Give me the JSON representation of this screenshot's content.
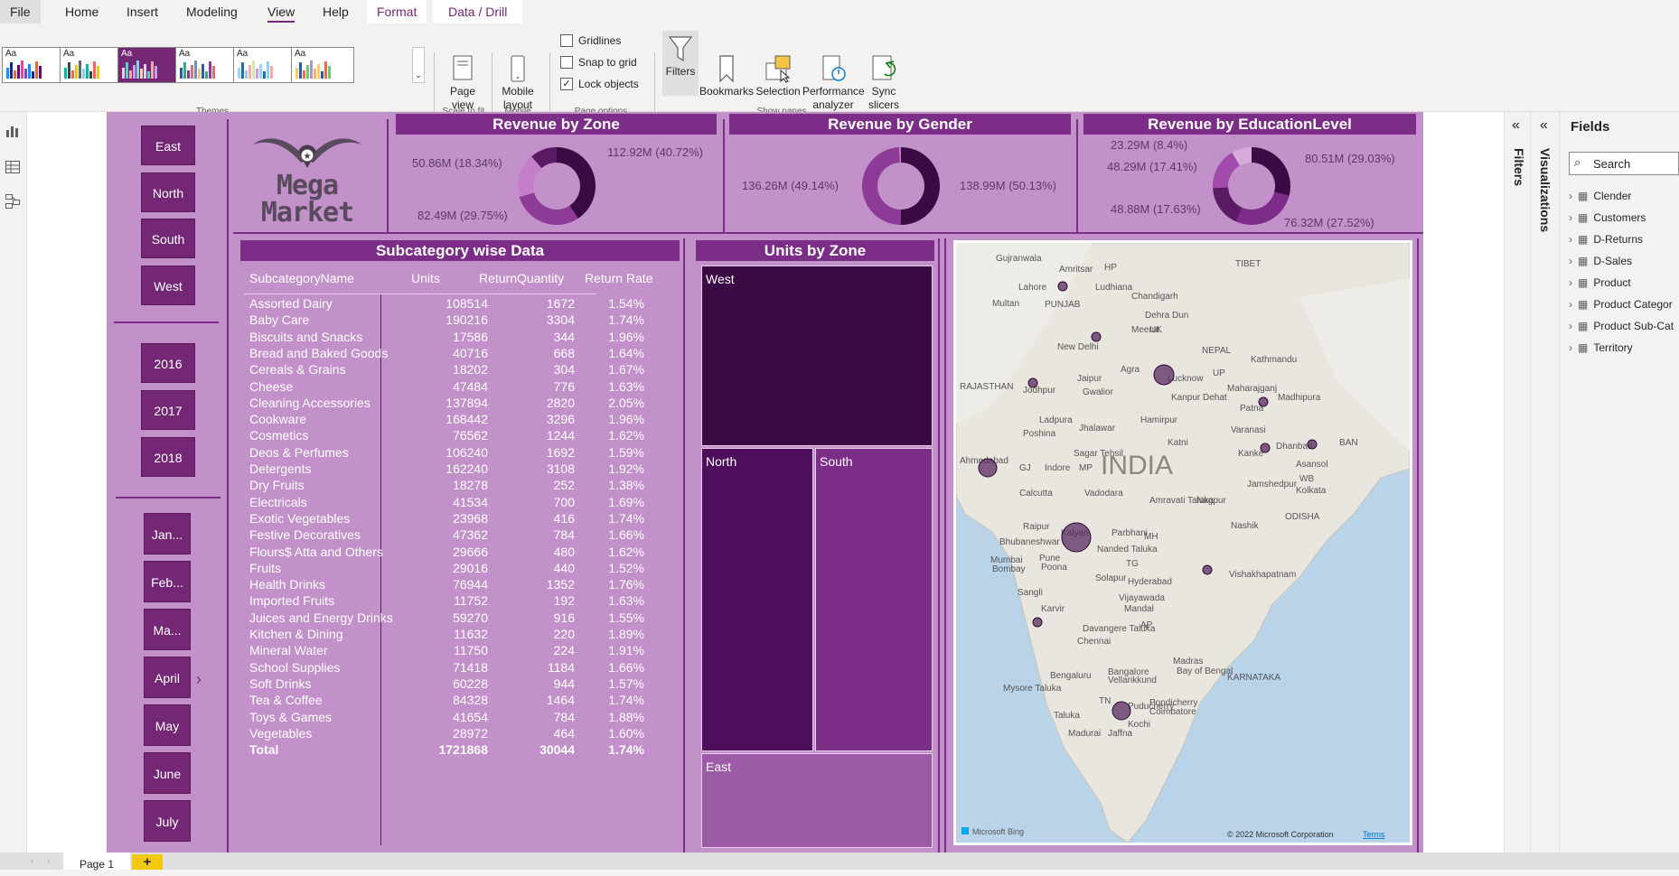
{
  "menu": {
    "file": "File",
    "home": "Home",
    "insert": "Insert",
    "modeling": "Modeling",
    "view": "View",
    "help": "Help",
    "format": "Format",
    "data_drill": "Data / Drill"
  },
  "ribbon": {
    "themes_label": "Themes",
    "page_view": "Page view",
    "mobile_layout": "Mobile layout",
    "scale_to_fit": "Scale to fit",
    "mobile": "Mobile",
    "gridlines": "Gridlines",
    "snap_to_grid": "Snap to grid",
    "lock_objects": "Lock objects",
    "page_options": "Page options",
    "filters": "Filters",
    "bookmarks": "Bookmarks",
    "selection": "Selection",
    "performance_analyzer": "Performance analyzer",
    "sync_slicers": "Sync slicers",
    "show_panes": "Show panes",
    "theme_aa": "Aa"
  },
  "logo": {
    "line1": "Mega",
    "line2": "Market"
  },
  "slicers": {
    "zones": [
      "East",
      "North",
      "South",
      "West"
    ],
    "years": [
      "2016",
      "2017",
      "2018"
    ],
    "months": [
      "Jan...",
      "Feb...",
      "Ma...",
      "April",
      "May",
      "June",
      "July"
    ]
  },
  "revenue_by_zone": {
    "title": "Revenue by Zone",
    "labels": [
      "112.92M (40.72%)",
      "50.86M (18.34%)",
      "82.49M (29.75%)"
    ],
    "slices": [
      40.72,
      29.75,
      18.34,
      11.19
    ],
    "colors": [
      "#3b0a45",
      "#8e3a97",
      "#c47ecb",
      "#5a1a64"
    ]
  },
  "revenue_by_gender": {
    "title": "Revenue by Gender",
    "labels": [
      "136.26M (49.14%)",
      "138.99M (50.13%)"
    ],
    "slices": [
      50.13,
      49.14,
      0.73
    ],
    "colors": [
      "#3b0a45",
      "#8e3a97",
      "#c47ecb"
    ]
  },
  "revenue_by_education": {
    "title": "Revenue by EducationLevel",
    "labels": [
      "23.29M (8.4%)",
      "80.51M (29.03%)",
      "48.29M (17.41%)",
      "48.88M (17.63%)",
      "76.32M (27.52%)"
    ],
    "slices": [
      29.03,
      27.52,
      17.63,
      17.41,
      8.4
    ],
    "colors": [
      "#3b0a45",
      "#7b2d87",
      "#5a1a64",
      "#a24bad",
      "#d7a9dc"
    ]
  },
  "table": {
    "title": "Subcategory wise Data",
    "columns": [
      "SubcategoryName",
      "Units",
      "ReturnQuantity",
      "Return Rate"
    ],
    "rows": [
      [
        "Assorted Dairy",
        "108514",
        "1672",
        "1.54%"
      ],
      [
        "Baby Care",
        "190216",
        "3304",
        "1.74%"
      ],
      [
        "Biscuits and Snacks",
        "17586",
        "344",
        "1.96%"
      ],
      [
        "Bread and Baked Goods",
        "40716",
        "668",
        "1.64%"
      ],
      [
        "Cereals & Grains",
        "18202",
        "304",
        "1.67%"
      ],
      [
        "Cheese",
        "47484",
        "776",
        "1.63%"
      ],
      [
        "Cleaning Accessories",
        "137894",
        "2820",
        "2.05%"
      ],
      [
        "Cookware",
        "168442",
        "3296",
        "1.96%"
      ],
      [
        "Cosmetics",
        "76562",
        "1244",
        "1.62%"
      ],
      [
        "Deos & Perfumes",
        "106240",
        "1692",
        "1.59%"
      ],
      [
        "Detergents",
        "162240",
        "3108",
        "1.92%"
      ],
      [
        "Dry Fruits",
        "18278",
        "252",
        "1.38%"
      ],
      [
        "Electricals",
        "41534",
        "700",
        "1.69%"
      ],
      [
        "Exotic Vegetables",
        "23968",
        "416",
        "1.74%"
      ],
      [
        "Festive Decoratives",
        "47362",
        "784",
        "1.66%"
      ],
      [
        "Flours$ Atta and Others",
        "29666",
        "480",
        "1.62%"
      ],
      [
        "Fruits",
        "29016",
        "440",
        "1.52%"
      ],
      [
        "Health Drinks",
        "76944",
        "1352",
        "1.76%"
      ],
      [
        "Imported Fruits",
        "11752",
        "192",
        "1.63%"
      ],
      [
        "Juices and Energy Drinks",
        "59270",
        "916",
        "1.55%"
      ],
      [
        "Kitchen & Dining",
        "11632",
        "220",
        "1.89%"
      ],
      [
        "Mineral Water",
        "11750",
        "224",
        "1.91%"
      ],
      [
        "School Supplies",
        "71418",
        "1184",
        "1.66%"
      ],
      [
        "Soft Drinks",
        "60228",
        "944",
        "1.57%"
      ],
      [
        "Tea & Coffee",
        "84328",
        "1464",
        "1.74%"
      ],
      [
        "Toys & Games",
        "41654",
        "784",
        "1.88%"
      ],
      [
        "Vegetables",
        "28972",
        "464",
        "1.60%"
      ]
    ],
    "total": [
      "Total",
      "1721868",
      "30044",
      "1.74%"
    ]
  },
  "units_by_zone": {
    "title": "Units by Zone",
    "zones": [
      "West",
      "North",
      "South",
      "East"
    ]
  },
  "map": {
    "country": "INDIA",
    "places": [
      "Gujranwala",
      "Amritsar",
      "HP",
      "Lahore",
      "Ludhiana",
      "Chandigarh",
      "TIBET",
      "Multan",
      "PUNJAB",
      "Dehra Dun",
      "Meerut",
      "UK",
      "New Delhi",
      "NEPAL",
      "RAJASTHAN",
      "Jaipur",
      "Agra",
      "Lucknow",
      "Kathmandu",
      "Jodhpur",
      "Gwalior",
      "Kanpur Dehat",
      "Maharajganj",
      "Madhipura",
      "UP",
      "Ladpura",
      "Hamirpur",
      "Patna",
      "Poshina",
      "Jhalawar",
      "Varanasi",
      "Katni",
      "Dhanbad",
      "BAN",
      "Sagar Tehsil",
      "Kanke",
      "Asansol",
      "Ahmedabad",
      "GJ",
      "Indore",
      "MP",
      "Jamshedpur",
      "WB",
      "Kolkata",
      "Calcutta",
      "Vadodara",
      "Amravati Taluka",
      "Nagpur",
      "Raipur",
      "Nashik",
      "ODISHA",
      "Bhubaneshwar",
      "Kalyan",
      "Parbhani",
      "Nanded Taluka",
      "MH",
      "Mumbai",
      "Bombay",
      "Pune",
      "Poona",
      "TG",
      "Solapur",
      "Hyderabad",
      "Vishakhapatnam",
      "Sangli",
      "Vijayawada",
      "Mandal",
      "Karvir",
      "AP",
      "Davangere Taluka",
      "Chennai",
      "Madras",
      "Bay of Bengal",
      "KARNATAKA",
      "Bengaluru",
      "Bangalore",
      "Vellarikkund",
      "Mysore Taluka",
      "TN",
      "Puducherry",
      "Pondicherry",
      "Coimbatore",
      "Taluka",
      "Kochi",
      "Madurai",
      "Jaffna"
    ],
    "bing": "Microsoft Bing",
    "copyright": "© 2022 Microsoft Corporation",
    "terms": "Terms"
  },
  "panes": {
    "filters": "Filters",
    "visualizations": "Visualizations",
    "fields": "Fields",
    "search_placeholder": "Search"
  },
  "fields": [
    "Clender",
    "Customers",
    "D-Returns",
    "D-Sales",
    "Product",
    "Product Categor",
    "Product Sub-Cat",
    "Territory"
  ],
  "pages": {
    "page1": "Page 1",
    "add": "+"
  }
}
